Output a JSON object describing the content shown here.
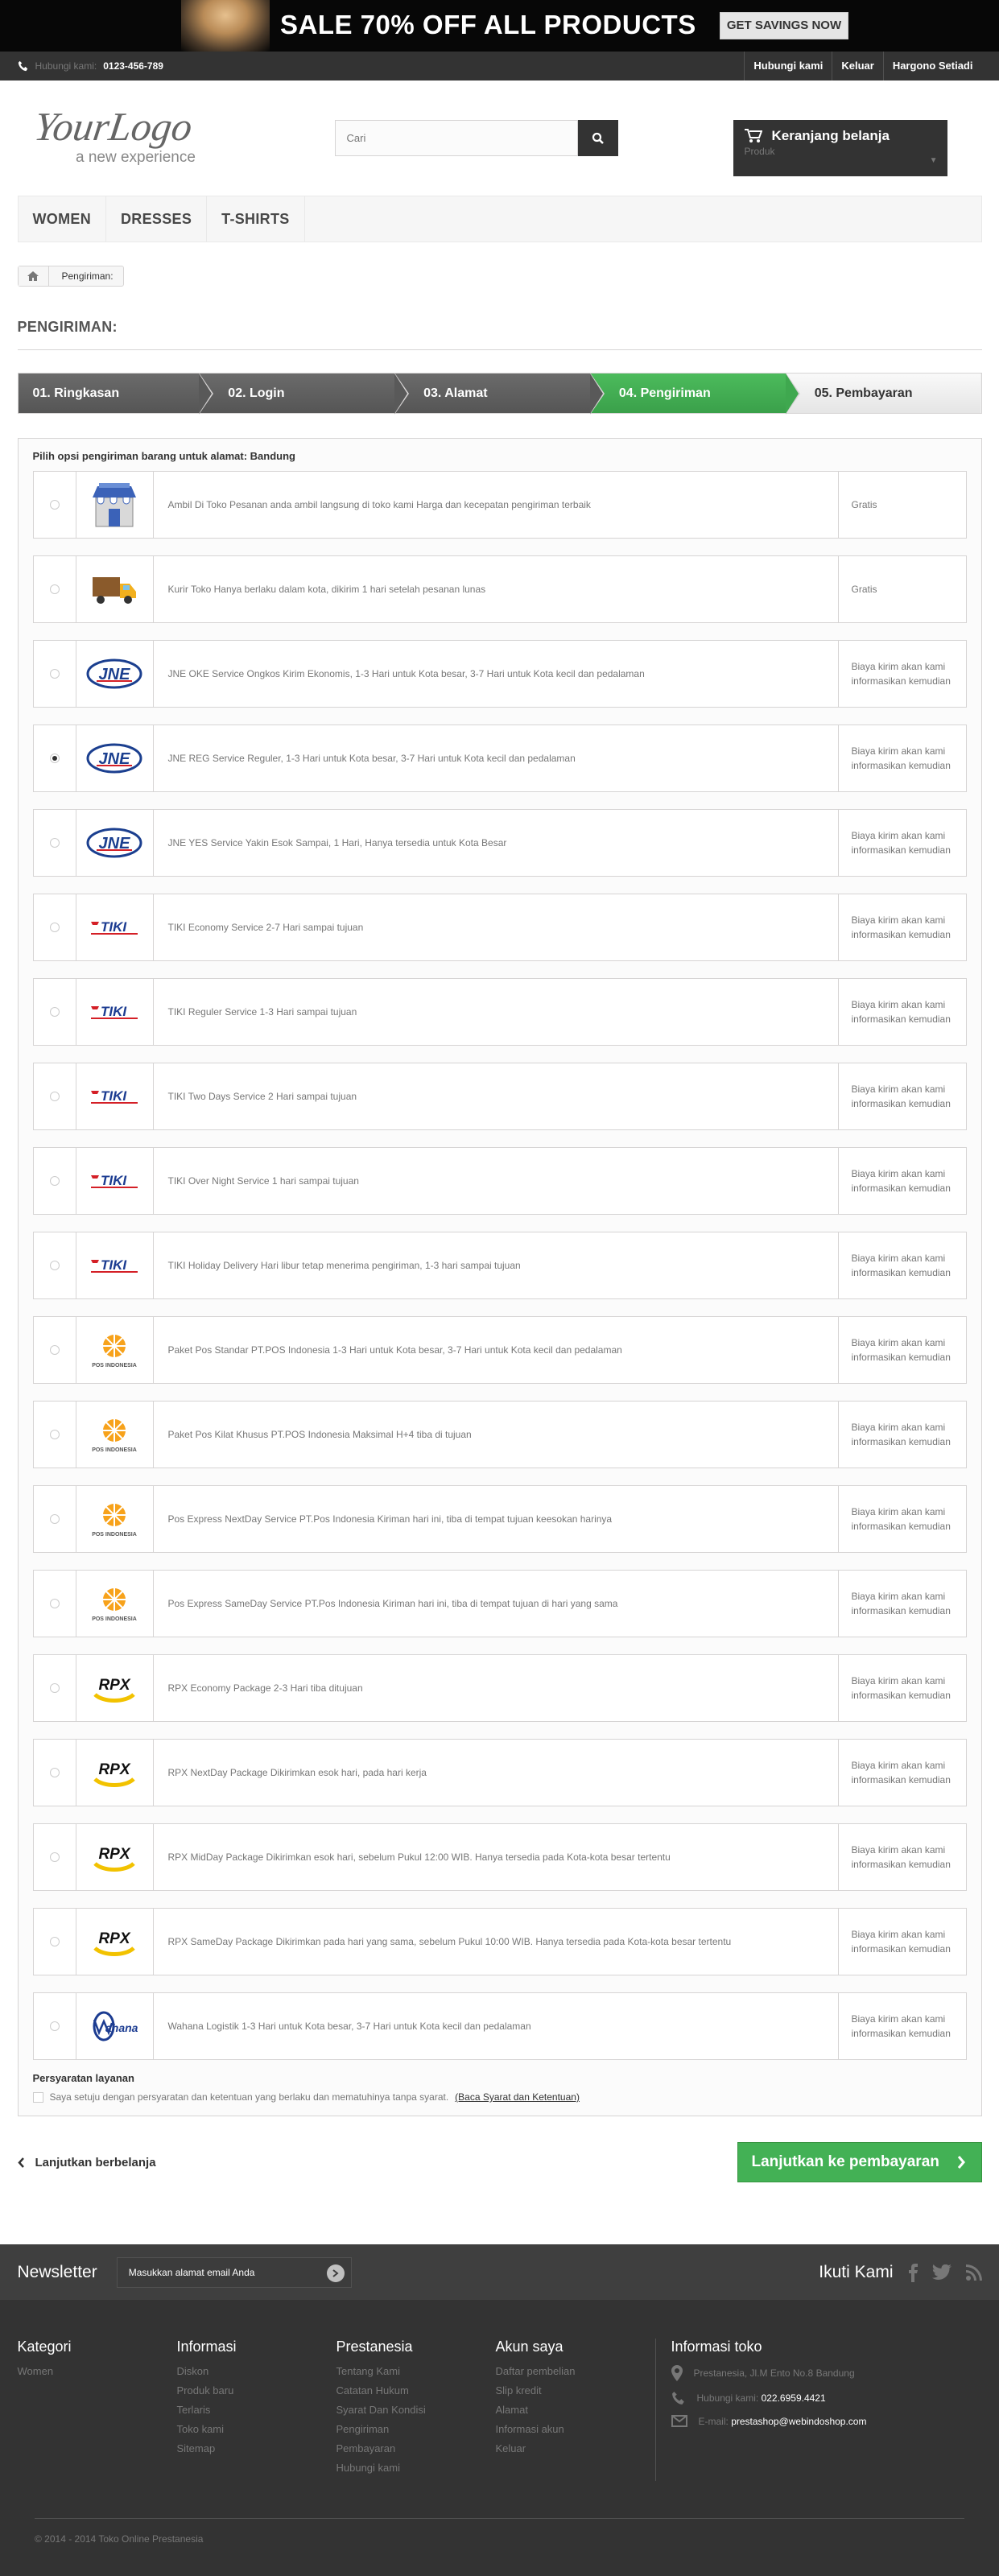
{
  "banner": {
    "headline": "SALE 70% OFF ALL PRODUCTS",
    "cta": "GET SAVINGS NOW"
  },
  "topnav": {
    "phone_label": "Hubungi kami:",
    "phone_number": "0123-456-789",
    "links": [
      "Hubungi kami",
      "Keluar",
      "Hargono Setiadi"
    ]
  },
  "header": {
    "logo_text": "YourLogo",
    "logo_tagline": "a new experience",
    "search_placeholder": "Cari",
    "cart_title": "Keranjang belanja",
    "cart_sub": "Produk"
  },
  "menu": [
    "WOMEN",
    "DRESSES",
    "T-SHIRTS"
  ],
  "breadcrumb": {
    "current": "Pengiriman:"
  },
  "page_title": "PENGIRIMAN:",
  "steps": [
    "01. Ringkasan",
    "02. Login",
    "03. Alamat",
    "04. Pengiriman",
    "05. Pembayaran"
  ],
  "shipping": {
    "heading": "Pilih opsi pengiriman barang untuk alamat: Bandung",
    "options": [
      {
        "logo": "store",
        "desc": "Ambil Di Toko Pesanan anda ambil langsung di toko kami Harga dan kecepatan pengiriman terbaik",
        "price": "Gratis"
      },
      {
        "logo": "truck",
        "desc": "Kurir Toko Hanya berlaku dalam kota, dikirim 1 hari setelah pesanan lunas",
        "price": "Gratis"
      },
      {
        "logo": "jne",
        "desc": "JNE OKE Service Ongkos Kirim Ekonomis, 1-3 Hari untuk Kota besar, 3-7 Hari untuk Kota kecil dan pedalaman",
        "price": "Biaya kirim akan kami informasikan kemudian"
      },
      {
        "logo": "jne",
        "desc": "JNE REG Service Reguler, 1-3 Hari untuk Kota besar, 3-7 Hari untuk Kota kecil dan pedalaman",
        "price": "Biaya kirim akan kami informasikan kemudian"
      },
      {
        "logo": "jne",
        "desc": "JNE YES Service Yakin Esok Sampai, 1 Hari, Hanya tersedia untuk Kota Besar",
        "price": "Biaya kirim akan kami informasikan kemudian"
      },
      {
        "logo": "tiki",
        "desc": "TIKI Economy Service 2-7 Hari sampai tujuan",
        "price": "Biaya kirim akan kami informasikan kemudian"
      },
      {
        "logo": "tiki",
        "desc": "TIKI Reguler Service 1-3 Hari sampai tujuan",
        "price": "Biaya kirim akan kami informasikan kemudian"
      },
      {
        "logo": "tiki",
        "desc": "TIKI Two Days Service 2 Hari sampai tujuan",
        "price": "Biaya kirim akan kami informasikan kemudian"
      },
      {
        "logo": "tiki",
        "desc": "TIKI Over Night Service 1 hari sampai tujuan",
        "price": "Biaya kirim akan kami informasikan kemudian"
      },
      {
        "logo": "tiki",
        "desc": "TIKI Holiday Delivery Hari libur tetap menerima pengiriman, 1-3 hari sampai tujuan",
        "price": "Biaya kirim akan kami informasikan kemudian"
      },
      {
        "logo": "pos",
        "desc": "Paket Pos Standar PT.POS Indonesia 1-3 Hari untuk Kota besar, 3-7 Hari untuk Kota kecil dan pedalaman",
        "price": "Biaya kirim akan kami informasikan kemudian"
      },
      {
        "logo": "pos",
        "desc": "Paket Pos Kilat Khusus PT.POS Indonesia Maksimal H+4 tiba di tujuan",
        "price": "Biaya kirim akan kami informasikan kemudian"
      },
      {
        "logo": "pos",
        "desc": "Pos Express NextDay Service PT.Pos Indonesia Kiriman hari ini, tiba di tempat tujuan keesokan harinya",
        "price": "Biaya kirim akan kami informasikan kemudian"
      },
      {
        "logo": "pos",
        "desc": "Pos Express SameDay Service PT.Pos Indonesia Kiriman hari ini, tiba di tempat tujuan di hari yang sama",
        "price": "Biaya kirim akan kami informasikan kemudian"
      },
      {
        "logo": "rpx",
        "desc": "RPX Economy Package 2-3 Hari tiba ditujuan",
        "price": "Biaya kirim akan kami informasikan kemudian"
      },
      {
        "logo": "rpx",
        "desc": "RPX NextDay Package Dikirimkan esok hari, pada hari kerja",
        "price": "Biaya kirim akan kami informasikan kemudian"
      },
      {
        "logo": "rpx",
        "desc": "RPX MidDay Package Dikirimkan esok hari, sebelum Pukul 12:00 WIB. Hanya tersedia pada Kota-kota besar tertentu",
        "price": "Biaya kirim akan kami informasikan kemudian"
      },
      {
        "logo": "rpx",
        "desc": "RPX SameDay Package Dikirimkan pada hari yang sama, sebelum Pukul 10:00 WIB. Hanya tersedia pada Kota-kota besar tertentu",
        "price": "Biaya kirim akan kami informasikan kemudian"
      },
      {
        "logo": "wahana",
        "desc": "Wahana Logistik 1-3 Hari untuk Kota besar, 3-7 Hari untuk Kota kecil dan pedalaman",
        "price": "Biaya kirim akan kami informasikan kemudian"
      }
    ],
    "selected_index": 3
  },
  "terms": {
    "title": "Persyaratan layanan",
    "text": "Saya setuju dengan persyaratan dan ketentuan yang berlaku dan mematuhinya tanpa syarat.",
    "link": "(Baca Syarat dan Ketentuan)"
  },
  "actions": {
    "back": "Lanjutkan berbelanja",
    "next": "Lanjutkan ke pembayaran"
  },
  "newsletter": {
    "title": "Newsletter",
    "placeholder": "Masukkan alamat email Anda",
    "follow": "Ikuti Kami"
  },
  "footer": {
    "columns": [
      {
        "title": "Kategori",
        "links": [
          "Women"
        ]
      },
      {
        "title": "Informasi",
        "links": [
          "Diskon",
          "Produk baru",
          "Terlaris",
          "Toko kami",
          "Sitemap"
        ]
      },
      {
        "title": "Prestanesia",
        "links": [
          "Tentang Kami",
          "Catatan Hukum",
          "Syarat Dan Kondisi",
          "Pengiriman",
          "Pembayaran",
          "Hubungi kami"
        ]
      },
      {
        "title": "Akun saya",
        "links": [
          "Daftar pembelian",
          "Slip kredit",
          "Alamat",
          "Informasi akun",
          "Keluar"
        ]
      }
    ],
    "store": {
      "title": "Informasi toko",
      "address": "Prestanesia, Jl.M Ento No.8 Bandung",
      "phone_label": "Hubungi kami:",
      "phone": "022.6959.4421",
      "email_label": "E-mail:",
      "email": "prestashop@webindoshop.com"
    },
    "copyright": "© 2014 - 2014 Toko Online Prestanesia"
  }
}
